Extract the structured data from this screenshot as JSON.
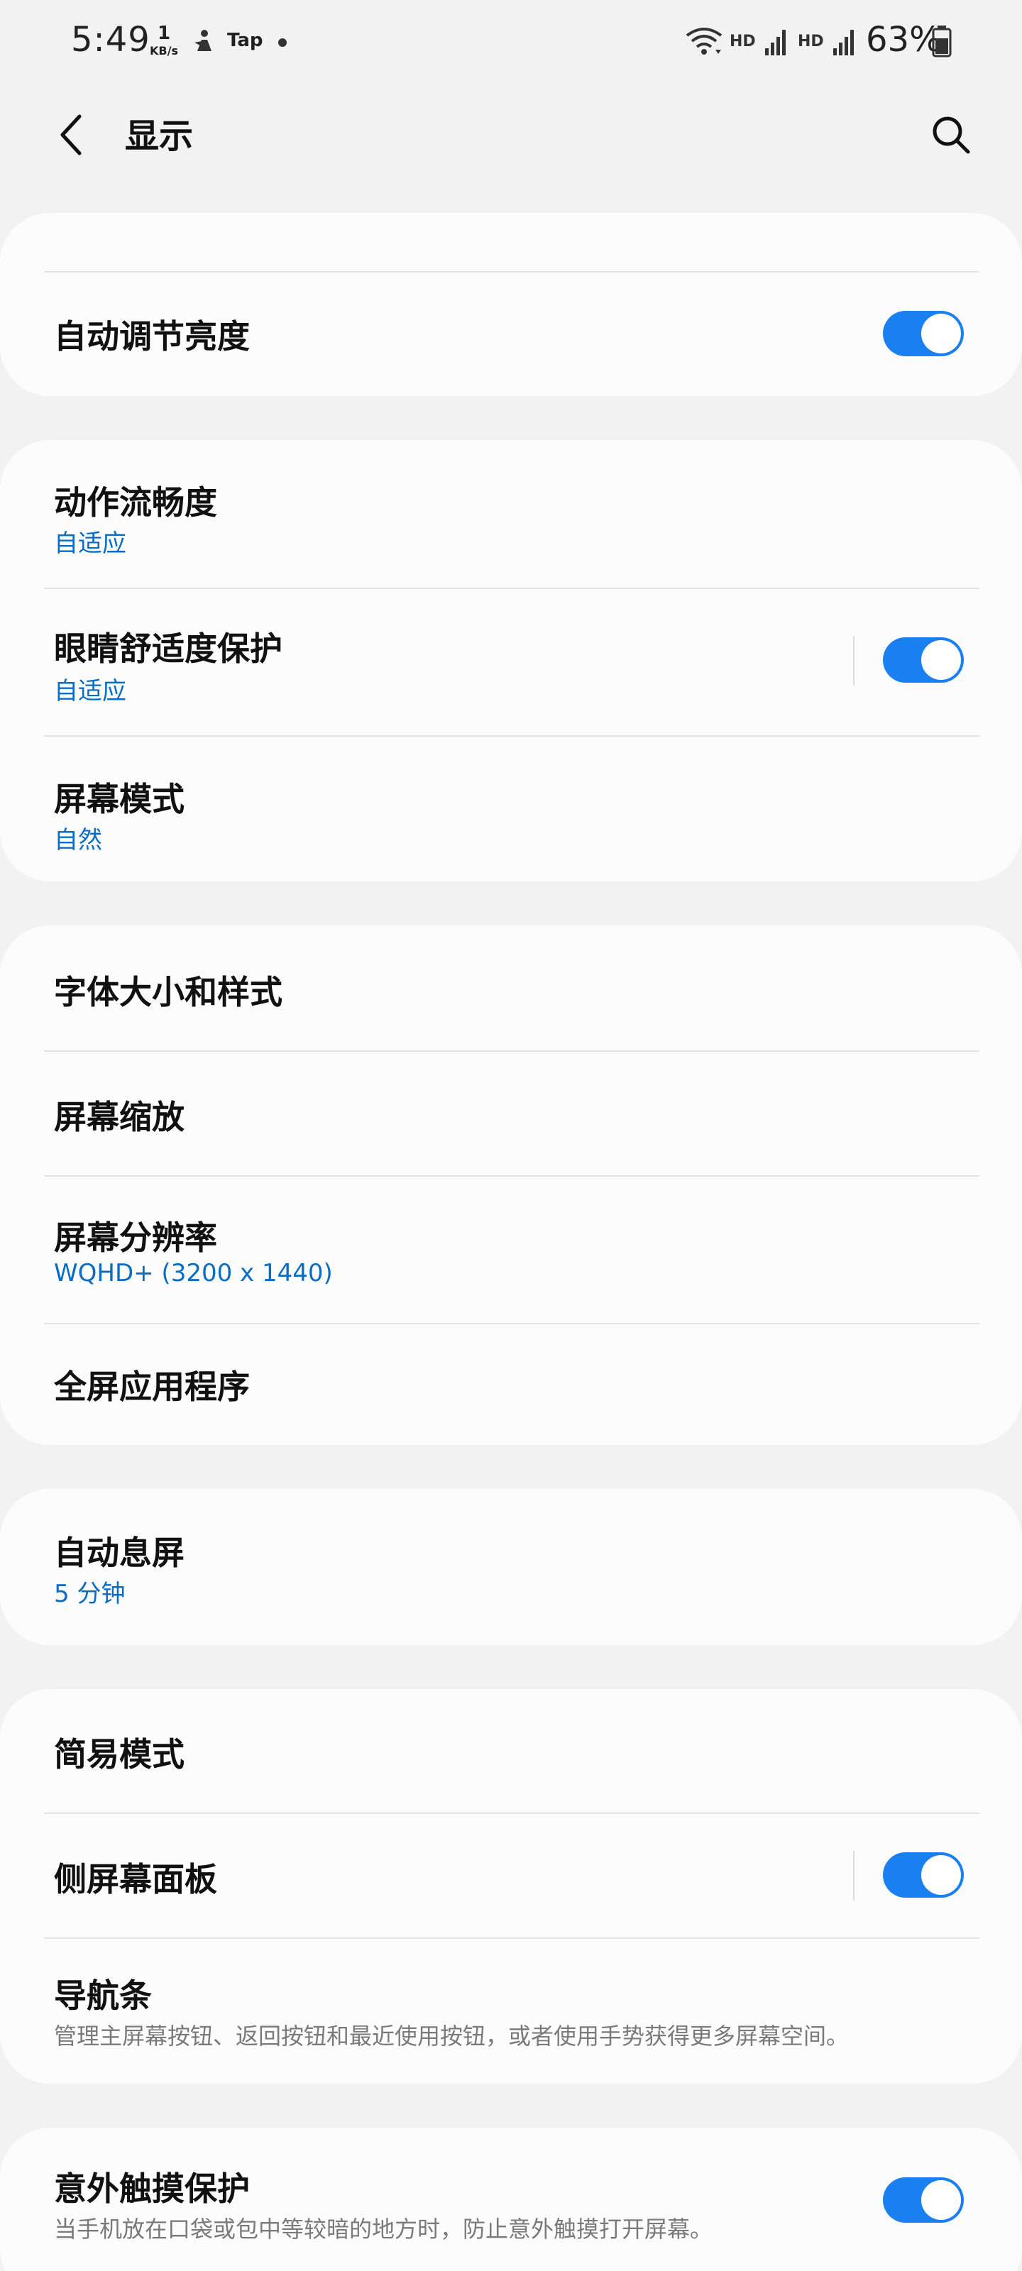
{
  "status_bar": {
    "time": "5:49",
    "net_speed_value": "1",
    "net_speed_unit": "KB/s",
    "app_label": "Tap",
    "hd1": "HD",
    "hd2": "HD",
    "battery": "63%"
  },
  "header": {
    "title": "显示"
  },
  "sections": {
    "brightness": {
      "auto_brightness_label": "自动调节亮度",
      "auto_brightness_on": true
    },
    "motion": {
      "smoothness_label": "动作流畅度",
      "smoothness_value": "自适应",
      "eye_comfort_label": "眼睛舒适度保护",
      "eye_comfort_value": "自适应",
      "eye_comfort_on": true,
      "screen_mode_label": "屏幕模式",
      "screen_mode_value": "自然"
    },
    "font": {
      "font_label": "字体大小和样式",
      "zoom_label": "屏幕缩放",
      "resolution_label": "屏幕分辨率",
      "resolution_value": "WQHD+ (3200 x 1440)",
      "fullscreen_label": "全屏应用程序"
    },
    "timeout": {
      "timeout_label": "自动息屏",
      "timeout_value": "5 分钟"
    },
    "misc": {
      "easy_mode_label": "简易模式",
      "edge_panels_label": "侧屏幕面板",
      "edge_panels_on": true,
      "navbar_label": "导航条",
      "navbar_desc": "管理主屏幕按钮、返回按钮和最近使用按钮，或者使用手势获得更多屏幕空间。"
    },
    "touch": {
      "touch_protect_label": "意外触摸保护",
      "touch_protect_desc": "当手机放在口袋或包中等较暗的地方时，防止意外触摸打开屏幕。",
      "touch_protect_on": true
    }
  },
  "colors": {
    "accent": "#1a7ff0",
    "subtext_blue": "#0a6dc4",
    "background": "#f2f2f2",
    "card": "#fcfcfc"
  }
}
